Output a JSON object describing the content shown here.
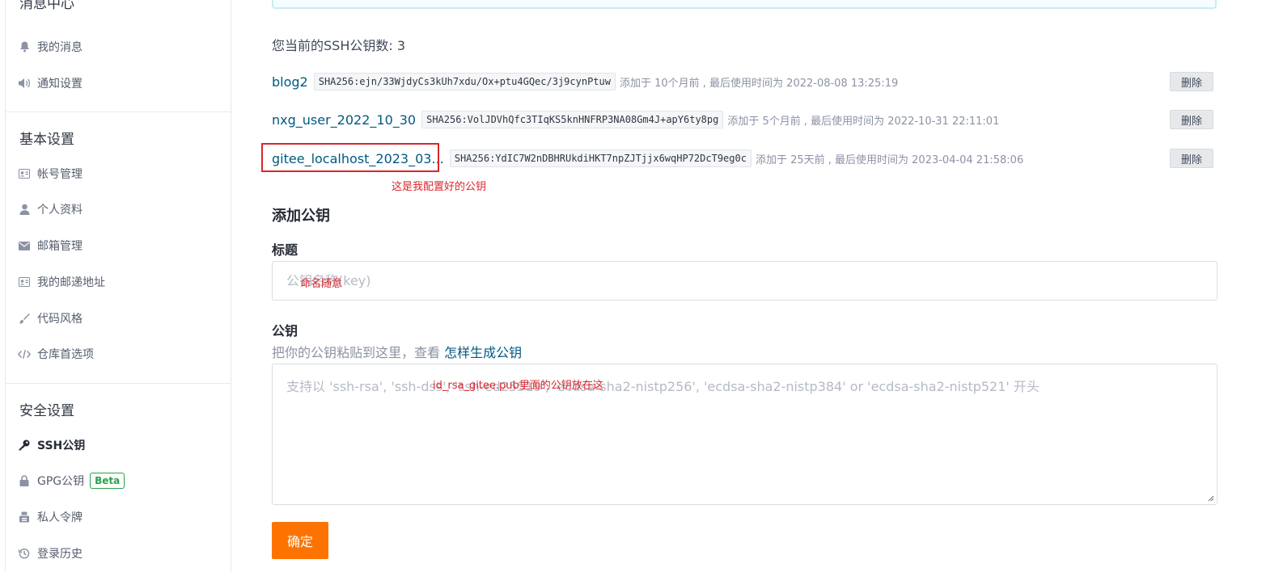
{
  "sidebar": {
    "groups": [
      {
        "title": "消息中心",
        "items": [
          {
            "label": "我的消息",
            "icon": "bell-icon"
          },
          {
            "label": "通知设置",
            "icon": "speaker-icon"
          }
        ]
      },
      {
        "title": "基本设置",
        "items": [
          {
            "label": "帐号管理",
            "icon": "id-card-icon"
          },
          {
            "label": "个人资料",
            "icon": "user-icon"
          },
          {
            "label": "邮箱管理",
            "icon": "envelope-icon"
          },
          {
            "label": "我的邮递地址",
            "icon": "address-card-icon"
          },
          {
            "label": "代码风格",
            "icon": "brush-icon"
          },
          {
            "label": "仓库首选项",
            "icon": "code-icon"
          }
        ]
      },
      {
        "title": "安全设置",
        "items": [
          {
            "label": "SSH公钥",
            "icon": "key-icon",
            "active": true
          },
          {
            "label": "GPG公钥",
            "icon": "lock-icon",
            "badge": "Beta"
          },
          {
            "label": "私人令牌",
            "icon": "token-icon"
          },
          {
            "label": "登录历史",
            "icon": "history-icon"
          }
        ]
      }
    ]
  },
  "main": {
    "key_count_text": "您当前的SSH公钥数: 3",
    "keys": [
      {
        "name": "blog2",
        "fingerprint": "SHA256:ejn/33WjdyCs3kUh7xdu/Ox+ptu4GQec/3j9cynPtuw",
        "meta": "添加于 10个月前 , 最后使用时间为 2022-08-08 13:25:19",
        "delete_label": "删除"
      },
      {
        "name": "nxg_user_2022_10_30",
        "fingerprint": "SHA256:VolJDVhQfc3TIqKS5knHNFRP3NA08Gm4J+apY6ty8pg",
        "meta": "添加于 5个月前 , 最后使用时间为 2022-10-31 22:11:01",
        "delete_label": "删除"
      },
      {
        "name": "gitee_localhost_2023_03...",
        "fingerprint": "SHA256:YdIC7W2nDBHRUkdiHKT7npZJTjjx6wqHP72DcT9eg0c",
        "meta": "添加于 25天前 , 最后使用时间为 2023-04-04 21:58:06",
        "delete_label": "删除"
      }
    ],
    "add_section_title": "添加公钥",
    "title_label": "标题",
    "title_placeholder": "公钥名称(key)",
    "key_label": "公钥",
    "help_prefix": "把你的公钥粘贴到这里，查看 ",
    "help_link": "怎样生成公钥",
    "key_placeholder": "支持以 'ssh-rsa', 'ssh-dss', 'ssh-ed25519', 'ecdsa-sha2-nistp256', 'ecdsa-sha2-nistp384' or 'ecdsa-sha2-nistp521' 开头",
    "submit_label": "确定"
  },
  "annotations": {
    "configured_key_note": "这是我配置好的公钥",
    "title_note": "命名随意",
    "key_note": "id_rsa_gitee.pub里面的公钥放在这"
  },
  "colors": {
    "accent_link": "#005980",
    "submit_orange": "#fe7300",
    "annotation_red": "#d9272d",
    "beta_green": "#2aa14a"
  }
}
